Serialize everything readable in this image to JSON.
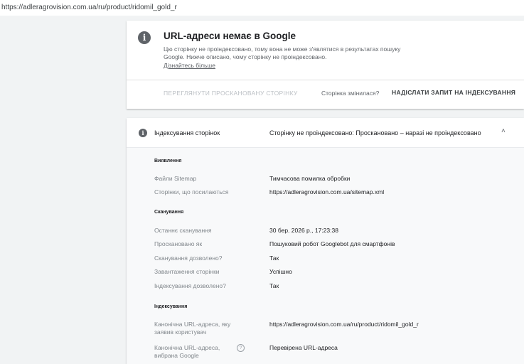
{
  "address_bar": {
    "url": "https://adleragrovision.com.ua/ru/product/ridomil_gold_r"
  },
  "status_card": {
    "title": "URL-адреси немає в Google",
    "description": "Цю сторінку не проіндексовано, тому вона не може з'являтися в результатах пошуку Google. Нижче описано, чому сторінку не проіндексовано.",
    "learn_more": "Дізнайтесь більше",
    "view_crawled": "ПЕРЕГЛЯНУТИ ПРОСКАНОВАНУ СТОРІНКУ",
    "page_changed": "Сторінка змінилася?",
    "request_indexing": "НАДІСЛАТИ ЗАПИТ НА ІНДЕКСУВАННЯ"
  },
  "indexing_card": {
    "label": "Індексування сторінок",
    "status": "Сторінку не проіндексовано: Проскановано – наразі не проіндексовано",
    "discovery": {
      "title": "Виявлення",
      "sitemaps_label": "Файли Sitemap",
      "sitemaps_value": "Тимчасова помилка обробки",
      "referring_label": "Сторінки, що посилаються",
      "referring_value": "https://adleragrovision.com.ua/sitemap.xml"
    },
    "crawl": {
      "title": "Сканування",
      "last_crawl_label": "Останнє сканування",
      "last_crawl_value": "30 бер. 2026 р., 17:23:38",
      "crawled_as_label": "Проскановано як",
      "crawled_as_value": "Пошуковий робот Googlebot для смартфонів",
      "crawl_allowed_label": "Сканування дозволено?",
      "crawl_allowed_value": "Так",
      "page_fetch_label": "Завантаження сторінки",
      "page_fetch_value": "Успішно",
      "indexing_allowed_label": "Індексування дозволено?",
      "indexing_allowed_value": "Так"
    },
    "indexing": {
      "title": "Індексування",
      "user_canonical_label": "Канонічна URL-адреса, яку заявив користувач",
      "user_canonical_value": "https://adleragrovision.com.ua/ru/product/ridomil_gold_r",
      "google_canonical_label": "Канонічна URL-адреса, вибрана Google",
      "google_canonical_value": "Перевірена URL-адреса"
    }
  }
}
